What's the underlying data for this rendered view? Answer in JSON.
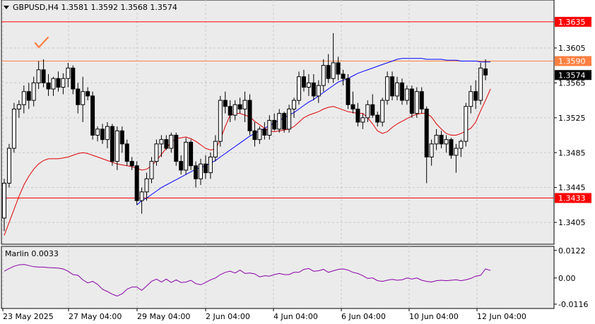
{
  "symbol_line": "GBPUSD,H4  1.3581 1.3592 1.3568 1.3574",
  "indicator_label": "Marlin 0.0033",
  "colors": {
    "background": "#ffffff",
    "plot_bg": "#ebebeb",
    "grid": "#c8c8c8",
    "candle": "#000000",
    "ma_long": "#0000ff",
    "ma_short": "#e00000",
    "oscillator": "#8a00a8",
    "level_red": "#ff0000",
    "level_orange": "#ff8040",
    "current_tag_bg": "#000000",
    "axis_text": "#000000"
  },
  "icons": {
    "menu": "triangle-down-icon",
    "checkmark": "checkmark-icon"
  },
  "chart_data": [
    {
      "type": "candlestick",
      "symbol": "GBPUSD",
      "timeframe": "H4",
      "ohlc_header": {
        "open": 1.3581,
        "high": 1.3592,
        "low": 1.3568,
        "close": 1.3574
      },
      "ylim": [
        1.338,
        1.366
      ],
      "y_ticks": [
        "1.3405",
        "1.3445",
        "1.3485",
        "1.3525",
        "1.3565",
        "1.3605"
      ],
      "x_labels": [
        "23 May 2025",
        "27 May 04:00",
        "29 May 04:00",
        "2 Jun 04:00",
        "4 Jun 04:00",
        "6 Jun 04:00",
        "10 Jun 04:00",
        "12 Jun 04:00"
      ],
      "horizontal_levels": [
        {
          "value": 1.3635,
          "label": "1.3635",
          "color": "#ff0000"
        },
        {
          "value": 1.359,
          "label": "1.3590",
          "color": "#ff8040"
        },
        {
          "value": 1.3433,
          "label": "1.3433",
          "color": "#ff0000"
        }
      ],
      "current_price": {
        "value": 1.3574,
        "label": "1.3574"
      },
      "candles": [
        [
          1.341,
          1.3455,
          1.3395,
          1.345
        ],
        [
          1.345,
          1.3495,
          1.3445,
          1.349
        ],
        [
          1.349,
          1.3542,
          1.3485,
          1.3535
        ],
        [
          1.3535,
          1.3545,
          1.3525,
          1.354
        ],
        [
          1.354,
          1.3562,
          1.353,
          1.3555
        ],
        [
          1.3555,
          1.3565,
          1.3535,
          1.3545
        ],
        [
          1.3545,
          1.3572,
          1.3538,
          1.3565
        ],
        [
          1.3565,
          1.359,
          1.3558,
          1.358
        ],
        [
          1.358,
          1.3592,
          1.356,
          1.3565
        ],
        [
          1.3565,
          1.3575,
          1.355,
          1.3558
        ],
        [
          1.3558,
          1.3572,
          1.355,
          1.357
        ],
        [
          1.357,
          1.3578,
          1.3555,
          1.356
        ],
        [
          1.356,
          1.3576,
          1.3552,
          1.357
        ],
        [
          1.357,
          1.3588,
          1.356,
          1.3582
        ],
        [
          1.3582,
          1.3585,
          1.3552,
          1.3558
        ],
        [
          1.3558,
          1.3565,
          1.353,
          1.354
        ],
        [
          1.354,
          1.3572,
          1.352,
          1.3555
        ],
        [
          1.3555,
          1.356,
          1.3545,
          1.355
        ],
        [
          1.355,
          1.3555,
          1.35,
          1.3505
        ],
        [
          1.3505,
          1.3515,
          1.3498,
          1.3512
        ],
        [
          1.3512,
          1.3518,
          1.3495,
          1.35
        ],
        [
          1.35,
          1.352,
          1.349,
          1.3515
        ],
        [
          1.3515,
          1.3518,
          1.347,
          1.3475
        ],
        [
          1.3475,
          1.3515,
          1.3465,
          1.351
        ],
        [
          1.351,
          1.3515,
          1.3485,
          1.3495
        ],
        [
          1.3495,
          1.35,
          1.347,
          1.3475
        ],
        [
          1.3475,
          1.348,
          1.3465,
          1.347
        ],
        [
          1.347,
          1.3475,
          1.3425,
          1.343
        ],
        [
          1.343,
          1.3445,
          1.3415,
          1.344
        ],
        [
          1.344,
          1.3462,
          1.343,
          1.3455
        ],
        [
          1.3455,
          1.348,
          1.345,
          1.3475
        ],
        [
          1.3475,
          1.35,
          1.347,
          1.3495
        ],
        [
          1.3495,
          1.3505,
          1.348,
          1.35
        ],
        [
          1.35,
          1.3505,
          1.3488,
          1.349
        ],
        [
          1.349,
          1.3508,
          1.3485,
          1.3505
        ],
        [
          1.3505,
          1.3508,
          1.347,
          1.3475
        ],
        [
          1.3475,
          1.3482,
          1.346,
          1.3465
        ],
        [
          1.3465,
          1.3502,
          1.346,
          1.3497
        ],
        [
          1.3497,
          1.35,
          1.3465,
          1.347
        ],
        [
          1.347,
          1.3475,
          1.3445,
          1.3455
        ],
        [
          1.3455,
          1.3478,
          1.3448,
          1.3472
        ],
        [
          1.3472,
          1.3482,
          1.3455,
          1.3462
        ],
        [
          1.3462,
          1.3485,
          1.3455,
          1.348
        ],
        [
          1.348,
          1.3505,
          1.3475,
          1.3498
        ],
        [
          1.3498,
          1.355,
          1.3492,
          1.3545
        ],
        [
          1.3545,
          1.3555,
          1.353,
          1.3538
        ],
        [
          1.3538,
          1.3545,
          1.352,
          1.3528
        ],
        [
          1.3528,
          1.3545,
          1.3522,
          1.354
        ],
        [
          1.354,
          1.3548,
          1.353,
          1.3535
        ],
        [
          1.3535,
          1.3555,
          1.352,
          1.3545
        ],
        [
          1.3545,
          1.3552,
          1.3505,
          1.351
        ],
        [
          1.351,
          1.352,
          1.3492,
          1.35
        ],
        [
          1.35,
          1.3515,
          1.3495,
          1.3512
        ],
        [
          1.3512,
          1.352,
          1.35,
          1.3505
        ],
        [
          1.3505,
          1.3528,
          1.35,
          1.3522
        ],
        [
          1.3522,
          1.353,
          1.351,
          1.3512
        ],
        [
          1.3512,
          1.3535,
          1.3508,
          1.353
        ],
        [
          1.353,
          1.3532,
          1.3508,
          1.3512
        ],
        [
          1.3512,
          1.354,
          1.3508,
          1.3535
        ],
        [
          1.3535,
          1.3548,
          1.3525,
          1.3545
        ],
        [
          1.3545,
          1.3578,
          1.354,
          1.3572
        ],
        [
          1.3572,
          1.358,
          1.3555,
          1.356
        ],
        [
          1.356,
          1.3575,
          1.355,
          1.3565
        ],
        [
          1.3565,
          1.3575,
          1.3545,
          1.355
        ],
        [
          1.355,
          1.3568,
          1.3542,
          1.3562
        ],
        [
          1.3562,
          1.3592,
          1.3555,
          1.3585
        ],
        [
          1.3585,
          1.3598,
          1.3565,
          1.357
        ],
        [
          1.357,
          1.3622,
          1.3565,
          1.3588
        ],
        [
          1.3588,
          1.3595,
          1.3568,
          1.3575
        ],
        [
          1.3575,
          1.358,
          1.3562,
          1.357
        ],
        [
          1.357,
          1.3575,
          1.3535,
          1.354
        ],
        [
          1.354,
          1.3555,
          1.353,
          1.3535
        ],
        [
          1.3535,
          1.3542,
          1.3515,
          1.352
        ],
        [
          1.352,
          1.353,
          1.3512,
          1.3525
        ],
        [
          1.3525,
          1.3545,
          1.352,
          1.354
        ],
        [
          1.354,
          1.3552,
          1.3525,
          1.3528
        ],
        [
          1.3528,
          1.3532,
          1.3515,
          1.352
        ],
        [
          1.352,
          1.3548,
          1.3515,
          1.3545
        ],
        [
          1.3545,
          1.3578,
          1.354,
          1.3572
        ],
        [
          1.3572,
          1.3578,
          1.3545,
          1.355
        ],
        [
          1.355,
          1.3572,
          1.3545,
          1.3565
        ],
        [
          1.3565,
          1.357,
          1.354,
          1.3545
        ],
        [
          1.3545,
          1.3562,
          1.354,
          1.3558
        ],
        [
          1.3558,
          1.3562,
          1.3525,
          1.353
        ],
        [
          1.353,
          1.356,
          1.3525,
          1.3555
        ],
        [
          1.3555,
          1.356,
          1.353,
          1.3535
        ],
        [
          1.3535,
          1.3538,
          1.345,
          1.348
        ],
        [
          1.348,
          1.35,
          1.347,
          1.3495
        ],
        [
          1.3495,
          1.3512,
          1.3488,
          1.3505
        ],
        [
          1.3505,
          1.351,
          1.349,
          1.3495
        ],
        [
          1.3495,
          1.3505,
          1.3485,
          1.35
        ],
        [
          1.35,
          1.3502,
          1.3478,
          1.3482
        ],
        [
          1.3482,
          1.3495,
          1.3462,
          1.349
        ],
        [
          1.349,
          1.35,
          1.348,
          1.3498
        ],
        [
          1.3498,
          1.3542,
          1.3492,
          1.3538
        ],
        [
          1.3538,
          1.3562,
          1.353,
          1.3555
        ],
        [
          1.3555,
          1.3568,
          1.3535,
          1.3545
        ],
        [
          1.3545,
          1.3588,
          1.354,
          1.3582
        ],
        [
          1.3581,
          1.3592,
          1.3568,
          1.3574
        ]
      ],
      "ma_long": [
        null,
        null,
        null,
        null,
        null,
        null,
        null,
        null,
        null,
        null,
        null,
        null,
        null,
        null,
        null,
        null,
        null,
        null,
        null,
        null,
        null,
        null,
        null,
        null,
        null,
        null,
        null,
        1.3425,
        1.343,
        1.3433,
        1.3437,
        1.3441,
        1.3445,
        1.3448,
        1.3451,
        1.3454,
        1.3457,
        1.346,
        1.3463,
        1.3466,
        1.3468,
        1.347,
        1.3473,
        1.3476,
        1.348,
        1.3484,
        1.3488,
        1.3492,
        1.3496,
        1.35,
        1.3504,
        1.3507,
        1.351,
        1.3513,
        1.3516,
        1.3519,
        1.3522,
        1.3525,
        1.3528,
        1.3531,
        1.3535,
        1.3539,
        1.3543,
        1.3546,
        1.355,
        1.3554,
        1.3558,
        1.3562,
        1.3566,
        1.3568,
        1.357,
        1.3573,
        1.3576,
        1.3578,
        1.358,
        1.3582,
        1.3584,
        1.3586,
        1.3588,
        1.359,
        1.3592,
        1.3593,
        1.3593,
        1.3593,
        1.3593,
        1.3593,
        1.3592,
        1.3592,
        1.3592,
        1.3592,
        1.3591,
        1.3591,
        1.3591,
        1.359,
        1.359,
        1.359,
        1.359,
        1.3589,
        1.3589,
        1.3589
      ],
      "ma_short": [
        1.339,
        1.3405,
        1.342,
        1.3435,
        1.3448,
        1.3458,
        1.3466,
        1.3472,
        1.3476,
        1.3478,
        1.3478,
        1.3478,
        1.3479,
        1.348,
        1.3482,
        1.3484,
        1.3485,
        1.3484,
        1.3482,
        1.348,
        1.3478,
        1.3476,
        1.3474,
        1.3472,
        1.3471,
        1.347,
        1.3469,
        1.3467,
        1.3465,
        1.3466,
        1.347,
        1.3476,
        1.3483,
        1.349,
        1.3497,
        1.3501,
        1.3502,
        1.3503,
        1.3501,
        1.3498,
        1.3494,
        1.349,
        1.3488,
        1.3489,
        1.35,
        1.3515,
        1.3528,
        1.353,
        1.353,
        1.3528,
        1.3526,
        1.3521,
        1.3517,
        1.3513,
        1.351,
        1.3509,
        1.351,
        1.3511,
        1.3512,
        1.3515,
        1.352,
        1.3525,
        1.3528,
        1.353,
        1.3532,
        1.3535,
        1.3537,
        1.3538,
        1.3536,
        1.3534,
        1.3532,
        1.3531,
        1.353,
        1.353,
        1.3525,
        1.3518,
        1.351,
        1.3507,
        1.3509,
        1.3514,
        1.3518,
        1.3521,
        1.3524,
        1.3527,
        1.3529,
        1.353,
        1.353,
        1.3526,
        1.3518,
        1.3512,
        1.3507,
        1.3505,
        1.3505,
        1.3507,
        1.351,
        1.3513,
        1.352,
        1.3533,
        1.3545,
        1.3558
      ]
    },
    {
      "type": "line",
      "name": "Marlin",
      "label": "Marlin 0.0033",
      "ylim": [
        -0.0135,
        0.014
      ],
      "y_ticks": [
        "0.0122",
        "0.00",
        "-0.0116"
      ],
      "values": [
        0.003,
        0.0042,
        0.0052,
        0.0058,
        0.006,
        0.0055,
        0.005,
        0.0048,
        0.0048,
        0.0046,
        0.0045,
        0.0044,
        0.004,
        0.003,
        0.0015,
        0.0012,
        -0.0008,
        -0.0022,
        -0.0015,
        -0.0028,
        -0.005,
        -0.006,
        -0.0072,
        -0.008,
        -0.007,
        -0.005,
        -0.004,
        -0.004,
        -0.0055,
        -0.0035,
        -0.0015,
        -0.0005,
        -0.0018,
        -0.0005,
        -0.002,
        -0.0008,
        -0.002,
        -0.0018,
        -0.001,
        -0.0025,
        -0.003,
        -0.002,
        -0.0008,
        0.0,
        0.0015,
        0.0025,
        0.003,
        0.0022,
        0.0035,
        0.002,
        0.0022,
        0.0018,
        0.0005,
        0.001,
        0.0008,
        0.0015,
        0.002,
        0.0015,
        0.0015,
        0.0025,
        0.0025,
        0.0038,
        0.0042,
        0.003,
        0.0032,
        0.0038,
        0.0025,
        0.0032,
        0.0038,
        0.004,
        0.0035,
        0.0025,
        0.002,
        0.001,
        -0.0002,
        0.0,
        -0.0012,
        -0.0015,
        -0.001,
        -0.0006,
        -0.001,
        -0.0008,
        0.0,
        -0.0005,
        0.0,
        -0.001,
        -0.0015,
        -0.0018,
        -0.0012,
        -0.001,
        -0.0012,
        -0.001,
        -0.0008,
        -0.0012,
        -0.0008,
        -0.0002,
        0.0008,
        0.0012,
        0.004,
        0.0033
      ]
    }
  ]
}
